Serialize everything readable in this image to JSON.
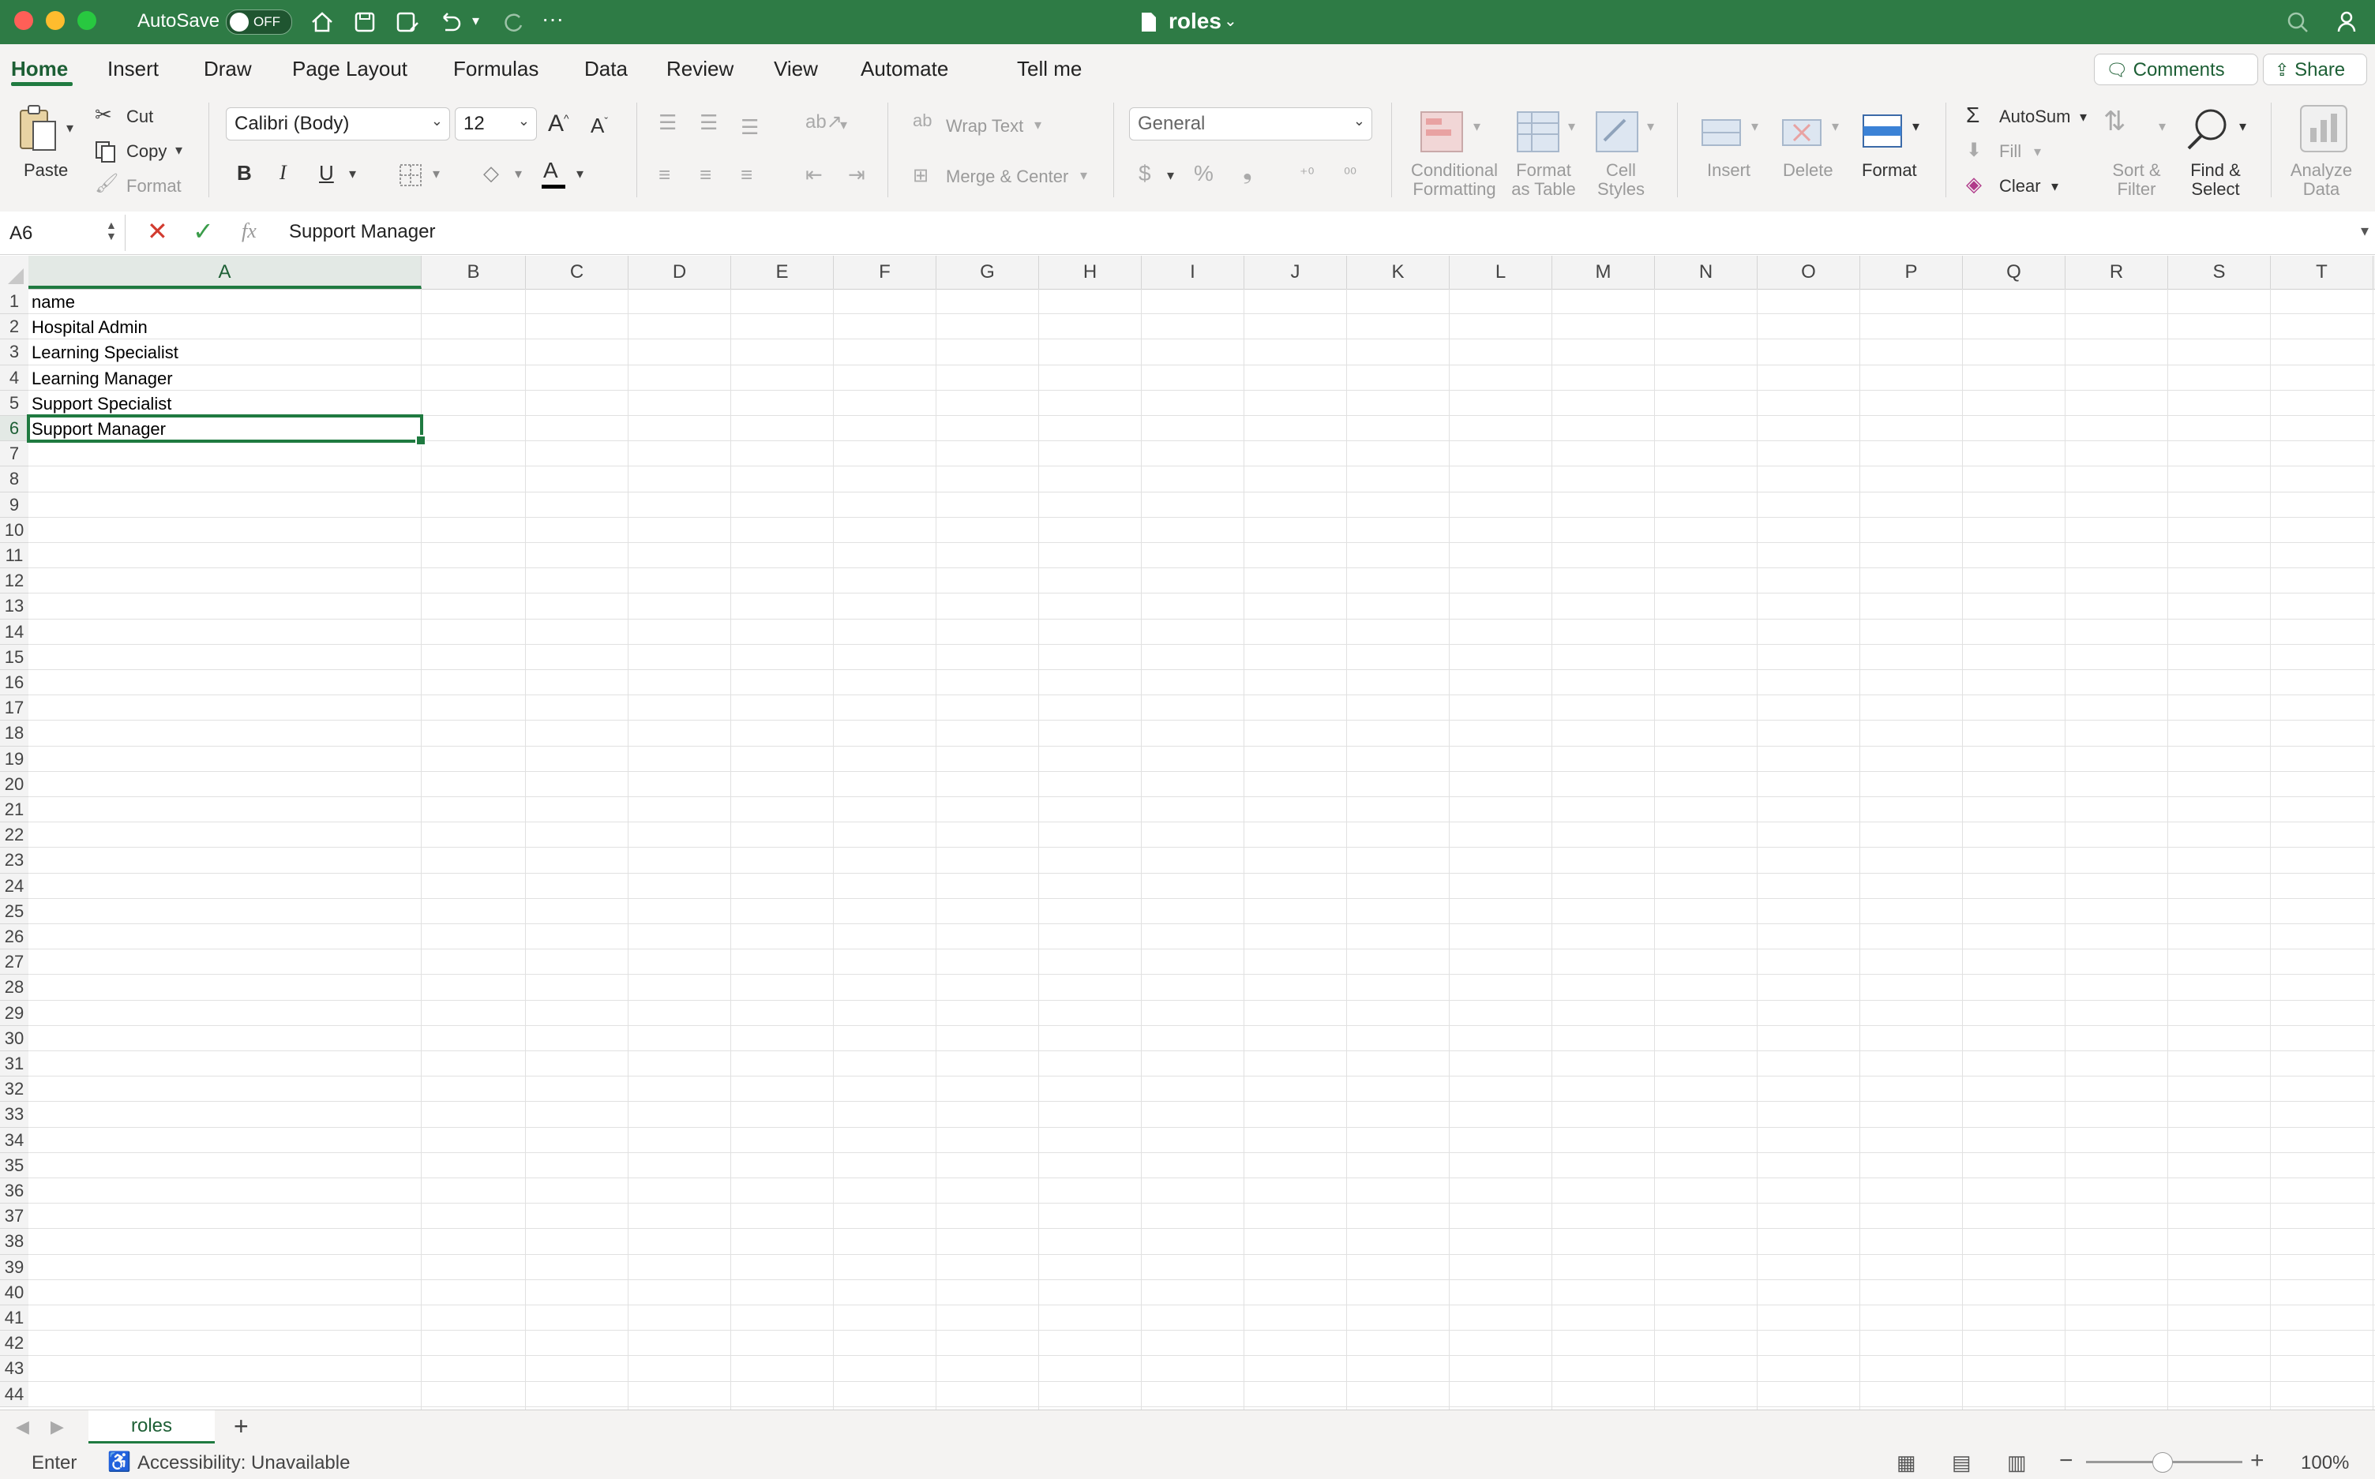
{
  "titlebar": {
    "autosave_label": "AutoSave",
    "autosave_state": "OFF",
    "doc_title": "roles"
  },
  "ribbon_tabs": [
    "Home",
    "Insert",
    "Draw",
    "Page Layout",
    "Formulas",
    "Data",
    "Review",
    "View",
    "Automate"
  ],
  "tell_me": "Tell me",
  "top_buttons": {
    "comments": "Comments",
    "share": "Share"
  },
  "clipboard": {
    "paste": "Paste",
    "cut": "Cut",
    "copy": "Copy",
    "format": "Format"
  },
  "font": {
    "name": "Calibri (Body)",
    "size": "12",
    "bold": "B",
    "italic": "I",
    "underline": "U",
    "color_letter": "A"
  },
  "alignment": {
    "wrap_text": "Wrap Text",
    "merge_center": "Merge & Center"
  },
  "number": {
    "format": "General",
    "currency": "$",
    "percent": "%",
    "comma": "❟"
  },
  "styles": {
    "conditional": [
      "Conditional",
      "Formatting"
    ],
    "format_table": [
      "Format",
      "as Table"
    ],
    "cell_styles": [
      "Cell",
      "Styles"
    ]
  },
  "cells_group": {
    "insert": "Insert",
    "delete": "Delete",
    "format": "Format"
  },
  "editing": {
    "autosum": "AutoSum",
    "fill": "Fill",
    "clear": "Clear",
    "sort_filter": [
      "Sort &",
      "Filter"
    ],
    "find_select": [
      "Find &",
      "Select"
    ],
    "analyze": [
      "Analyze",
      "Data"
    ]
  },
  "formula_bar": {
    "name_box": "A6",
    "fx": "fx",
    "content": "Support Manager"
  },
  "columns": [
    "A",
    "B",
    "C",
    "D",
    "E",
    "F",
    "G",
    "H",
    "I",
    "J",
    "K",
    "L",
    "M",
    "N",
    "O",
    "P",
    "Q",
    "R",
    "S",
    "T"
  ],
  "rows": [
    "1",
    "2",
    "3",
    "4",
    "5",
    "6",
    "7",
    "8",
    "9",
    "10",
    "11",
    "12",
    "13",
    "14",
    "15",
    "16",
    "17",
    "18",
    "19",
    "20",
    "21",
    "22",
    "23",
    "24",
    "25",
    "26",
    "27",
    "28",
    "29",
    "30",
    "31",
    "32",
    "33",
    "34",
    "35",
    "36",
    "37",
    "38",
    "39",
    "40",
    "41",
    "42",
    "43",
    "44"
  ],
  "cells": [
    "name",
    "Hospital Admin",
    "Learning Specialist",
    "Learning Manager",
    "Support Specialist",
    "Support Manager"
  ],
  "sheet_tabs": {
    "active": "roles",
    "add": "+"
  },
  "status": {
    "mode": "Enter",
    "accessibility": "Accessibility: Unavailable",
    "zoom": "100%"
  },
  "colors": {
    "accent": "#2e7b45",
    "selection": "#1f7a40"
  }
}
